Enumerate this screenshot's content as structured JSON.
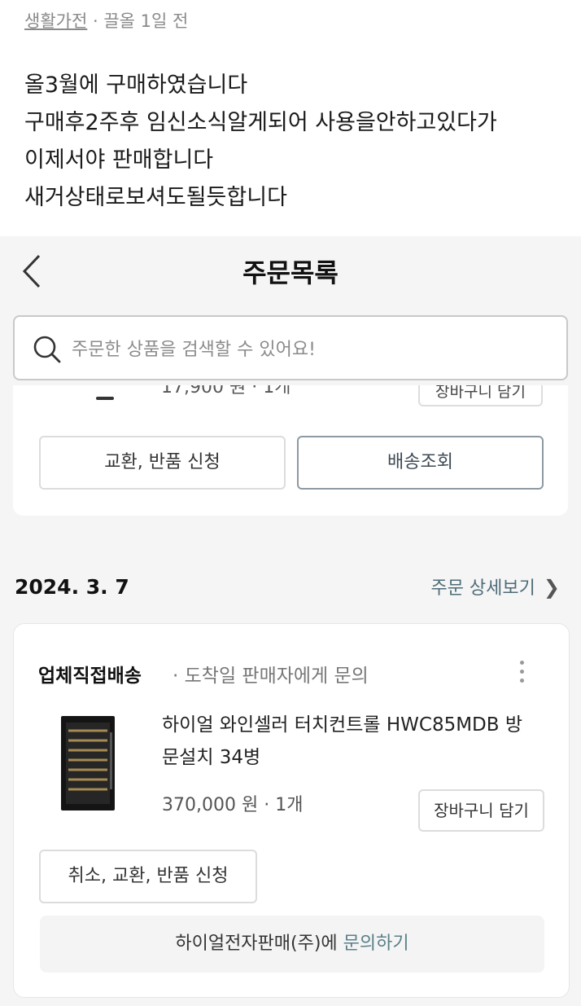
{
  "post": {
    "category": "생활가전",
    "meta": "· 끌올 1일 전",
    "lines": [
      "올3월에 구매하였습니다",
      "구매후2주후 임신소식알게되어 사용을안하고있다가",
      "이제서야 판매합니다",
      "새거상태로보셔도될듯합니다"
    ]
  },
  "header": {
    "title": "주문목록",
    "back_icon": "chevron-left-icon"
  },
  "search": {
    "placeholder": "주문한 상품을 검색할 수 있어요!",
    "icon": "search-icon"
  },
  "previous_order": {
    "cut_price_text": "17,900 원 · 1개",
    "cut_cart_label": "장바구니 담기",
    "exchange_label": "교환, 반품 신청",
    "tracking_label": "배송조회"
  },
  "order": {
    "date": "2024. 3. 7",
    "detail_link": "주문 상세보기",
    "shipping_type": "업체직접배송",
    "shipping_note": "· 도착일 판매자에게 문의",
    "product_name": "하이얼 와인셀러 터치컨트롤 HWC85MDB 방문설치 34병",
    "price": "370,000 원",
    "quantity": "· 1개",
    "cart_label": "장바구니 담기",
    "cancel_label": "취소, 교환, 반품 신청",
    "seller": "하이얼전자판매(주)에",
    "inquiry": "문의하기"
  },
  "colors": {
    "link": "#4f6c78",
    "inquiry": "#5a7f89",
    "tracking_border": "#8e9aa3"
  }
}
